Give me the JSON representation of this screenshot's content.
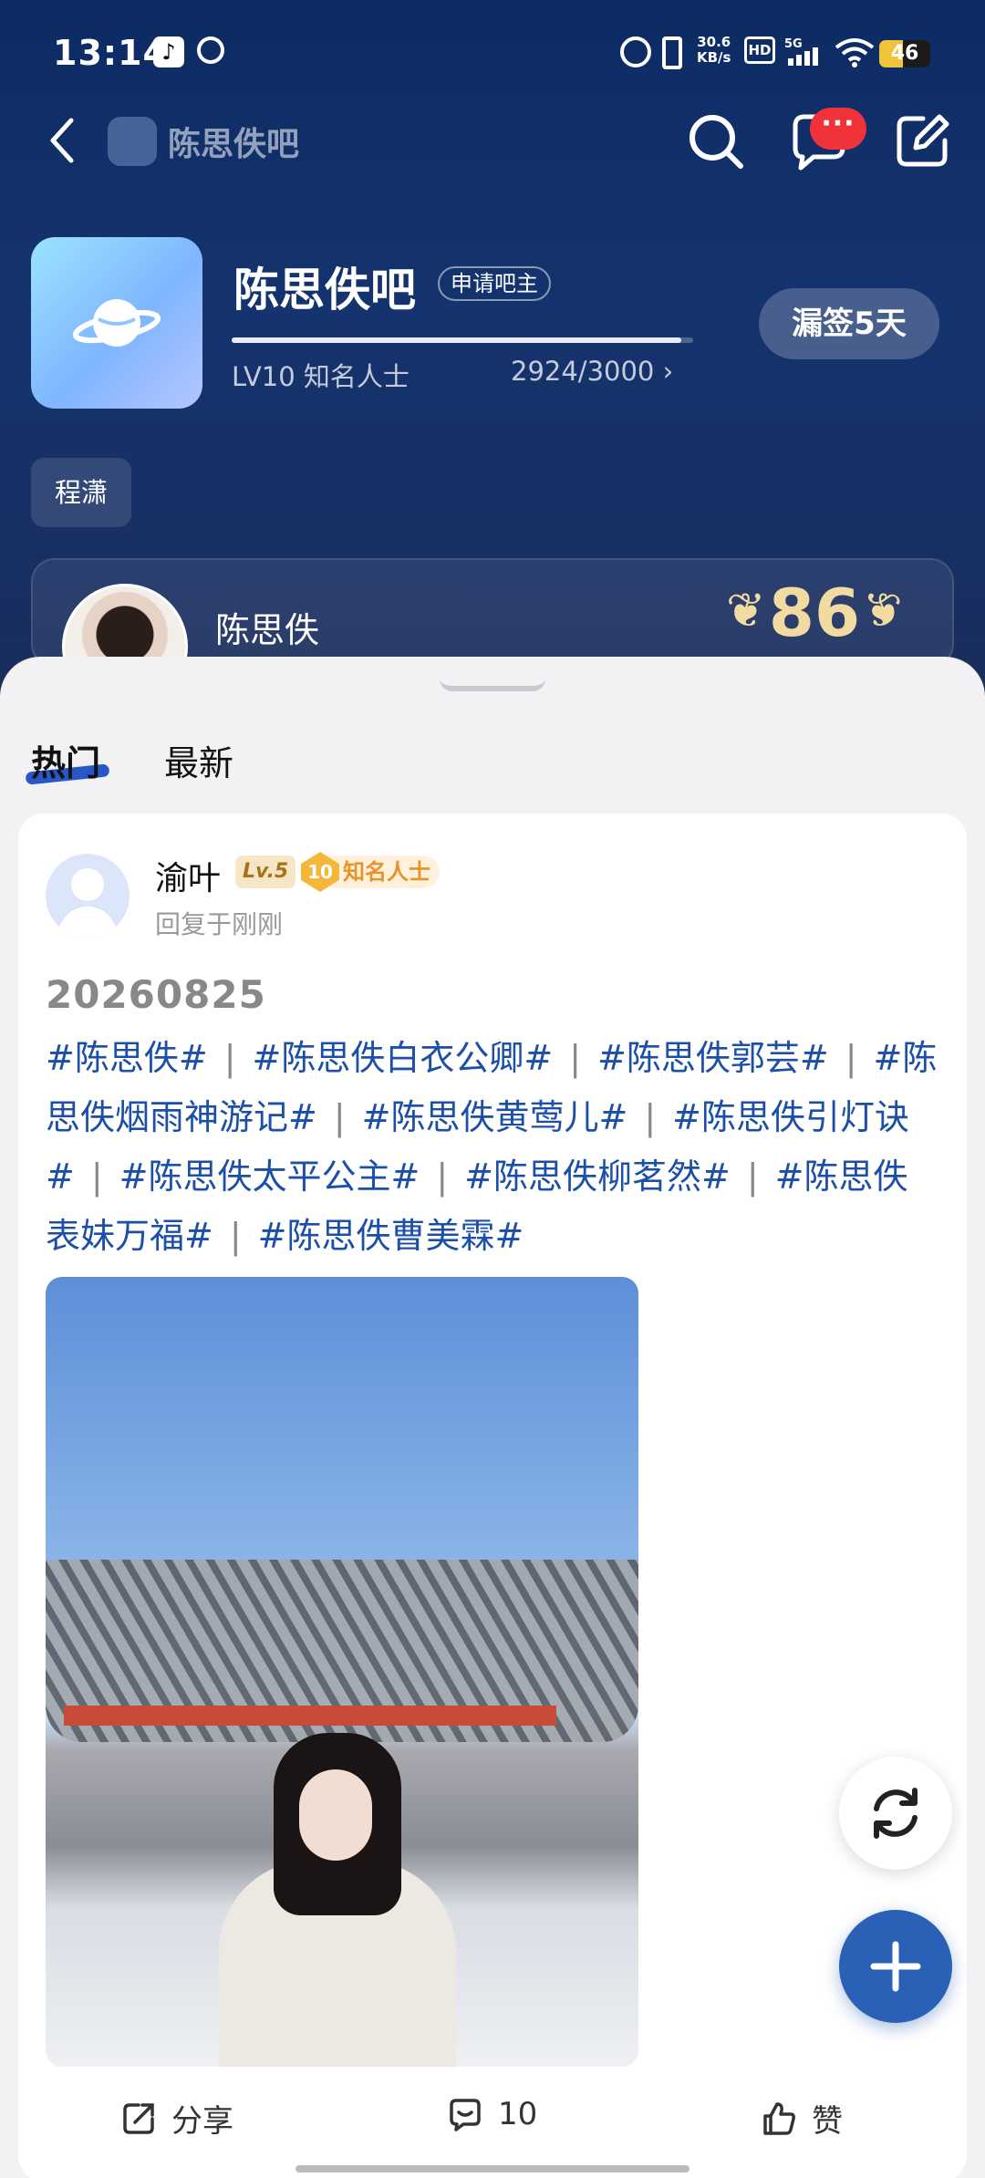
{
  "status_bar": {
    "time": "13:14",
    "net_speed_top": "30.6",
    "net_speed_bottom": "KB/s",
    "hd": "HD",
    "network": "5G",
    "battery": "46",
    "battery_level": 0.46
  },
  "nav": {
    "forum_title": "陈思佚吧",
    "message_badge": "···"
  },
  "forum": {
    "name": "陈思佚吧",
    "apply_owner": "申请吧主",
    "level": "LV10 知名人士",
    "exp": "2924/3000",
    "exp_fraction": 0.975,
    "signin": "漏签5天",
    "tag": "程潇"
  },
  "star": {
    "name": "陈思佚",
    "score": "86"
  },
  "tabs": [
    {
      "label": "热门"
    },
    {
      "label": "最新"
    }
  ],
  "post": {
    "author": "渝叶",
    "lv": "Lv.5",
    "fame_level": "10",
    "fame_title": "知名人士",
    "reply_time": "回复于刚刚",
    "date": "20260825",
    "tags": [
      "#陈思佚#",
      "#陈思佚白衣公卿#",
      "#陈思佚郭芸#",
      "#陈思佚烟雨神游记#",
      "#陈思佚黄莺儿#",
      "#陈思佚引灯诀#",
      "#陈思佚太平公主#",
      "#陈思佚柳茗然#",
      "#陈思佚表妹万福#",
      "#陈思佚曹美霖#"
    ],
    "tag_separator": "|"
  },
  "actions": {
    "share": "分享",
    "comment_count": "10",
    "like": "赞"
  }
}
